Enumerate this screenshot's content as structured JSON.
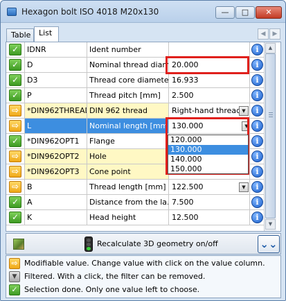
{
  "window": {
    "title": "Hexagon bolt ISO 4018 M20x130",
    "minimize": "—",
    "maximize": "□",
    "close": "✕"
  },
  "tabs": [
    {
      "label": "Table"
    },
    {
      "label": "List"
    }
  ],
  "rows": [
    {
      "status": "check",
      "name": "IDNR",
      "desc": "Ident number",
      "value": ""
    },
    {
      "status": "check",
      "name": "D",
      "desc": "Nominal thread diam...",
      "value": "20.000"
    },
    {
      "status": "check",
      "name": "D3",
      "desc": "Thread core diamete...",
      "value": "16.933"
    },
    {
      "status": "check",
      "name": "P",
      "desc": "Thread pitch [mm]",
      "value": "2.500"
    },
    {
      "status": "arrow",
      "name": "*DIN962THREAD",
      "desc": "DIN 962 thread",
      "value": "Right-hand thread"
    },
    {
      "status": "arrow",
      "name": "L",
      "desc": "Nominal length [mm]",
      "value": "130.000"
    },
    {
      "status": "check",
      "name": "*DIN962OPT1",
      "desc": "Flange",
      "value": ""
    },
    {
      "status": "arrow",
      "name": "*DIN962OPT2",
      "desc": "Hole",
      "value": ""
    },
    {
      "status": "arrow",
      "name": "*DIN962OPT3",
      "desc": "Cone point",
      "value": ""
    },
    {
      "status": "arrow",
      "name": "B",
      "desc": "Thread length [mm]",
      "value": "122.500"
    },
    {
      "status": "check",
      "name": "A",
      "desc": "Distance from the la...",
      "value": "7.500"
    },
    {
      "status": "check",
      "name": "K",
      "desc": "Head height",
      "value": "12.500"
    }
  ],
  "dropdown": {
    "options": [
      "120.000",
      "130.000",
      "140.000",
      "150.000"
    ],
    "selected": "130.000"
  },
  "info_glyph": "i",
  "toolbar": {
    "label": "Recalculate 3D geometry on/off",
    "collapse_glyph": "⌄⌄"
  },
  "legend": [
    {
      "icon": "arrow",
      "glyph": "⇨",
      "text": "Modifiable value. Change value with click on the value column."
    },
    {
      "icon": "filter",
      "glyph": "▼",
      "text": "Filtered. With a click, the filter can be removed."
    },
    {
      "icon": "check",
      "glyph": "✓",
      "text": "Selection done. Only one value left to choose."
    }
  ]
}
